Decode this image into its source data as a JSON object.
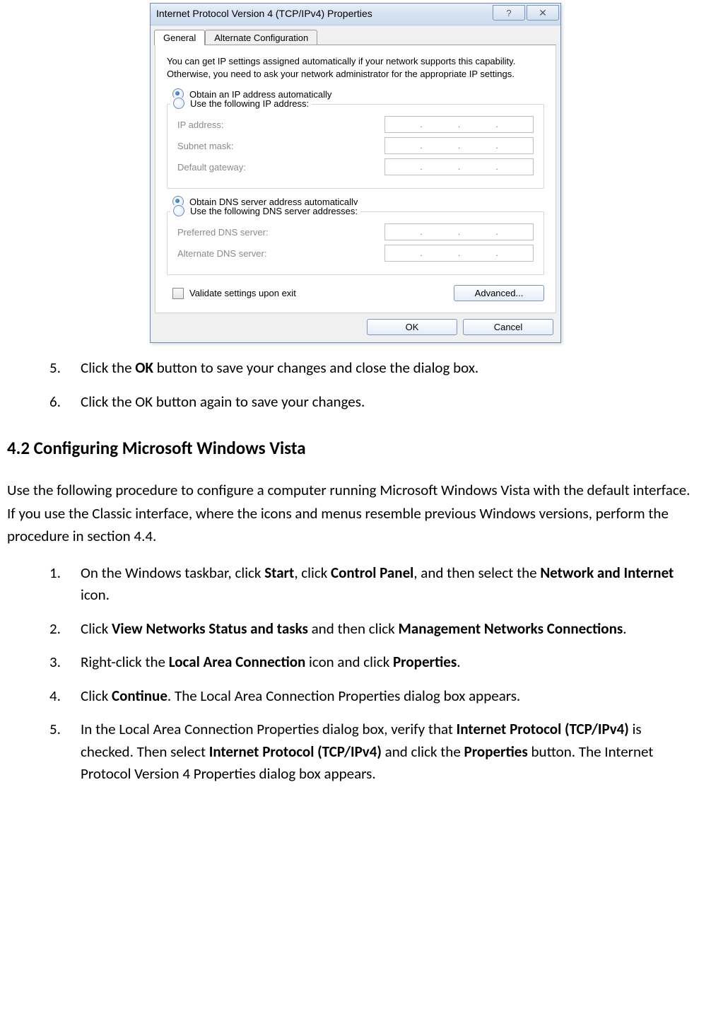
{
  "dialog": {
    "title": "Internet Protocol Version 4 (TCP/IPv4) Properties",
    "tabs": {
      "general": "General",
      "alternate": "Alternate Configuration"
    },
    "description": "You can get IP settings assigned automatically if your network supports this capability. Otherwise, you need to ask your network administrator for the appropriate IP settings.",
    "ip": {
      "auto_label": "Obtain an IP address automatically",
      "manual_label": "Use the following IP address:",
      "ip_address": "IP address:",
      "subnet": "Subnet mask:",
      "gateway": "Default gateway:"
    },
    "dns": {
      "auto_label": "Obtain DNS server address automatically",
      "manual_label": "Use the following DNS server addresses:",
      "preferred": "Preferred DNS server:",
      "alternate": "Alternate DNS server:"
    },
    "validate_label": "Validate settings upon exit",
    "advanced_btn": "Advanced...",
    "ok_btn": "OK",
    "cancel_btn": "Cancel"
  },
  "doc": {
    "steps_top": [
      {
        "n": "5.",
        "html": "Click the <b>OK</b> button to save your changes and close the dialog box."
      },
      {
        "n": "6.",
        "html": "Click the OK button again to save your changes."
      }
    ],
    "heading": "4.2 Configuring Microsoft Windows Vista",
    "intro": "Use the following procedure to configure a computer running Microsoft Windows Vista with the default interface. If you use the Classic interface, where the icons and menus resemble previous Windows versions, perform the procedure in section 4.4.",
    "steps_bottom": [
      {
        "n": "1.",
        "html": "On the Windows taskbar, click <b>Start</b>, click <b>Control Panel</b>, and then select the <b>Network and Internet</b> icon."
      },
      {
        "n": "2.",
        "html": "Click <b>View Networks Status and tasks</b> and then click <b>Management Networks Connections</b>."
      },
      {
        "n": "3.",
        "html": "Right-click the <b>Local Area Connection</b> icon and click <b>Properties</b>."
      },
      {
        "n": "4.",
        "html": "Click <b>Continue</b>. The Local Area Connection Properties dialog box appears."
      },
      {
        "n": "5.",
        "html": "In the Local Area Connection Properties dialog box, verify that <b>Internet Protocol (TCP/IPv4)</b> is checked. Then select <b>Internet Protocol (TCP/IPv4)</b> and click the <b>Properties</b> button. The Internet Protocol Version 4 Properties dialog box appears."
      }
    ]
  }
}
